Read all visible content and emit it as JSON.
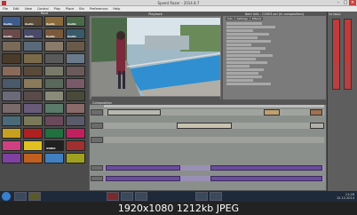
{
  "window": {
    "title": "Speed Razor - 2014.8.7"
  },
  "menu": [
    "File",
    "Edit",
    "View",
    "Control",
    "Play",
    "Place",
    "Bin",
    "Preferences",
    "Help"
  ],
  "panes": {
    "bins": "Root",
    "playback": "Playback",
    "info": "Item Info - C0003.avi (in composition)",
    "vu": "VU Meter",
    "composition": "Composition"
  },
  "info_tabs": [
    "Info",
    "Settings",
    "Effects"
  ],
  "bin_thumbs": [
    {
      "label": "Audio",
      "color": "#3e5b8a"
    },
    {
      "label": "Audio",
      "color": "#5a4a3a"
    },
    {
      "label": "Audio",
      "color": "#8a6a3a"
    },
    {
      "label": "Audio",
      "color": "#4a6a4a"
    },
    {
      "label": "Audio",
      "color": "#6a4a4a"
    },
    {
      "label": "Audio",
      "color": "#4a4a6a"
    },
    {
      "label": "Audio",
      "color": "#7a5a3a"
    },
    {
      "label": "Audio",
      "color": "#3a5a6a"
    },
    {
      "label": "",
      "color": "#7a6a5a"
    },
    {
      "label": "",
      "color": "#5a6a7a"
    },
    {
      "label": "",
      "color": "#8a7a6a"
    },
    {
      "label": "",
      "color": "#6a5a4a"
    },
    {
      "label": "",
      "color": "#4a3a2a"
    },
    {
      "label": "",
      "color": "#7a6a4a"
    },
    {
      "label": "",
      "color": "#5a5a5a"
    },
    {
      "label": "",
      "color": "#6a7a8a"
    },
    {
      "label": "",
      "color": "#8a6a5a"
    },
    {
      "label": "",
      "color": "#5a4a3a"
    },
    {
      "label": "",
      "color": "#7a7a6a"
    },
    {
      "label": "",
      "color": "#6a5a5a"
    },
    {
      "label": "",
      "color": "#4a5a6a"
    },
    {
      "label": "",
      "color": "#8a7a5a"
    },
    {
      "label": "",
      "color": "#5a6a5a"
    },
    {
      "label": "",
      "color": "#7a5a6a"
    },
    {
      "label": "",
      "color": "#6a6a7a"
    },
    {
      "label": "",
      "color": "#5a4a4a"
    },
    {
      "label": "",
      "color": "#8a8a7a"
    },
    {
      "label": "",
      "color": "#4a4a3a"
    },
    {
      "label": "",
      "color": "#7a6a6a"
    },
    {
      "label": "",
      "color": "#6a5a7a"
    },
    {
      "label": "",
      "color": "#5a7a6a"
    },
    {
      "label": "",
      "color": "#8a6a6a"
    },
    {
      "label": "",
      "color": "#4a6a7a"
    },
    {
      "label": "",
      "color": "#7a7a5a"
    },
    {
      "label": "",
      "color": "#6a4a5a"
    },
    {
      "label": "",
      "color": "#5a5a6a"
    },
    {
      "label": "",
      "color": "#c8a020"
    },
    {
      "label": "",
      "color": "#b02020"
    },
    {
      "label": "",
      "color": "#207040"
    },
    {
      "label": "",
      "color": "#c02060"
    },
    {
      "label": "",
      "color": "#d04080"
    },
    {
      "label": "",
      "color": "#e0c020"
    },
    {
      "label": "VIDEO",
      "color": "#202020"
    },
    {
      "label": "",
      "color": "#a03030"
    },
    {
      "label": "",
      "color": "#8040a0"
    },
    {
      "label": "",
      "color": "#c06020"
    },
    {
      "label": "",
      "color": "#4080c0"
    },
    {
      "label": "",
      "color": "#a0a020"
    }
  ],
  "taskbar": {
    "time": "11:26",
    "date": "12.12.2014"
  },
  "caption": {
    "text": "1920x1080  1212kb  JPEG"
  }
}
